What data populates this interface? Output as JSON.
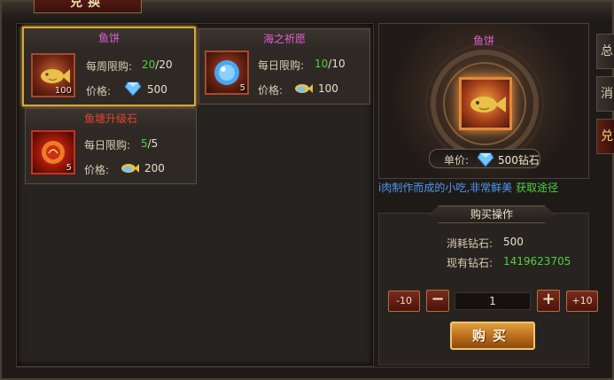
{
  "window": {
    "title": "兑换"
  },
  "items": [
    {
      "name": "鱼饼",
      "limit_label": "每周限购:",
      "limit_used": "20",
      "limit_total": "/20",
      "price_label": "价格:",
      "price": "500",
      "currency_icon": "diamond-icon",
      "count": "100",
      "title_color": "#e25fd6",
      "selected": true
    },
    {
      "name": "海之祈愿",
      "limit_label": "每日限购:",
      "limit_used": "10",
      "limit_total": "/10",
      "price_label": "价格:",
      "price": "100",
      "currency_icon": "fish-coin-icon",
      "count": "5",
      "title_color": "#e25fd6",
      "selected": false
    },
    {
      "name": "鱼塘升级石",
      "limit_label": "每日限购:",
      "limit_used": "5",
      "limit_total": "/5",
      "price_label": "价格:",
      "price": "200",
      "currency_icon": "fish-coin-icon",
      "count": "5",
      "title_color": "#e8402f",
      "selected": false
    }
  ],
  "preview": {
    "title": "鱼饼",
    "unit_price_label": "单价:",
    "unit_price_value": "500钻石",
    "description": "i肉制作而成的小吃,非常鲜美",
    "source_link": "获取途径"
  },
  "purchase": {
    "header": "购买操作",
    "cost_label": "消耗钻石:",
    "cost_value": "500",
    "owned_label": "现有钻石:",
    "owned_value": "1419623705",
    "minus10_label": "-10",
    "minus_label": "−",
    "quantity": "1",
    "plus_label": "+",
    "plus10_label": "+10",
    "buy_label": "购买"
  },
  "side_tabs": [
    "总",
    "消",
    "兑"
  ],
  "colors": {
    "accent_green": "#4fd13f",
    "accent_pink": "#e25fd6",
    "accent_gold": "#d8a43a",
    "link_blue": "#4f9af0"
  }
}
